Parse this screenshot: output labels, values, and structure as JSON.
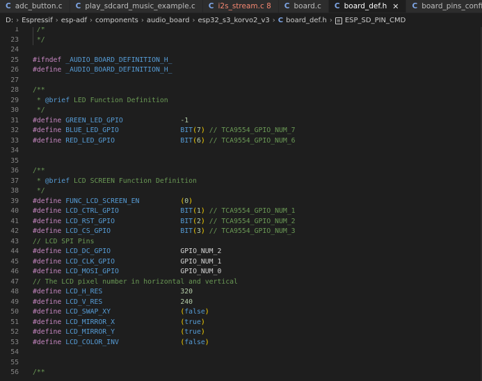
{
  "tabs": [
    {
      "label": "adc_button.c",
      "icon": "c-icon",
      "active": false,
      "error": false
    },
    {
      "label": "play_sdcard_music_example.c",
      "icon": "c-icon",
      "active": false,
      "error": false
    },
    {
      "label": "i2s_stream.c 8",
      "icon": "c-icon",
      "active": false,
      "error": true
    },
    {
      "label": "board.c",
      "icon": "c-icon",
      "active": false,
      "error": false
    },
    {
      "label": "board_def.h",
      "icon": "c-icon",
      "active": true,
      "error": false
    },
    {
      "label": "board_pins_config.c",
      "icon": "c-icon",
      "active": false,
      "error": false
    }
  ],
  "breadcrumb": {
    "items": [
      "D:",
      "Espressif",
      "esp-adf",
      "components",
      "audio_board",
      "esp32_s3_korvo2_v3",
      "board_def.h",
      "ESP_SD_PIN_CMD"
    ]
  },
  "editor": {
    "lines": [
      {
        "num": "1",
        "text": " /*"
      },
      {
        "num": "23",
        "text": " */"
      },
      {
        "num": "24",
        "text": ""
      },
      {
        "num": "25",
        "text": "#ifndef _AUDIO_BOARD_DEFINITION_H_"
      },
      {
        "num": "26",
        "text": "#define _AUDIO_BOARD_DEFINITION_H_"
      },
      {
        "num": "27",
        "text": ""
      },
      {
        "num": "28",
        "text": "/**"
      },
      {
        "num": "29",
        "text": " * @brief LED Function Definition"
      },
      {
        "num": "30",
        "text": " */"
      },
      {
        "num": "31",
        "text": "#define GREEN_LED_GPIO              -1"
      },
      {
        "num": "32",
        "text": "#define BLUE_LED_GPIO               BIT(7) // TCA9554_GPIO_NUM_7"
      },
      {
        "num": "33",
        "text": "#define RED_LED_GPIO                BIT(6) // TCA9554_GPIO_NUM_6"
      },
      {
        "num": "34",
        "text": ""
      },
      {
        "num": "35",
        "text": ""
      },
      {
        "num": "36",
        "text": "/**"
      },
      {
        "num": "37",
        "text": " * @brief LCD SCREEN Function Definition"
      },
      {
        "num": "38",
        "text": " */"
      },
      {
        "num": "39",
        "text": "#define FUNC_LCD_SCREEN_EN          (0)"
      },
      {
        "num": "40",
        "text": "#define LCD_CTRL_GPIO               BIT(1) // TCA9554_GPIO_NUM_1"
      },
      {
        "num": "41",
        "text": "#define LCD_RST_GPIO                BIT(2) // TCA9554_GPIO_NUM_2"
      },
      {
        "num": "42",
        "text": "#define LCD_CS_GPIO                 BIT(3) // TCA9554_GPIO_NUM_3"
      },
      {
        "num": "43",
        "text": "// LCD SPI Pins"
      },
      {
        "num": "44",
        "text": "#define LCD_DC_GPIO                 GPIO_NUM_2"
      },
      {
        "num": "45",
        "text": "#define LCD_CLK_GPIO                GPIO_NUM_1"
      },
      {
        "num": "46",
        "text": "#define LCD_MOSI_GPIO               GPIO_NUM_0"
      },
      {
        "num": "47",
        "text": "// The LCD pixel number in horizontal and vertical"
      },
      {
        "num": "48",
        "text": "#define LCD_H_RES                   320"
      },
      {
        "num": "49",
        "text": "#define LCD_V_RES                   240"
      },
      {
        "num": "50",
        "text": "#define LCD_SWAP_XY                 (false)"
      },
      {
        "num": "51",
        "text": "#define LCD_MIRROR_X                (true)"
      },
      {
        "num": "52",
        "text": "#define LCD_MIRROR_Y                (true)"
      },
      {
        "num": "53",
        "text": "#define LCD_COLOR_INV               (false)"
      },
      {
        "num": "54",
        "text": ""
      },
      {
        "num": "55",
        "text": ""
      },
      {
        "num": "56",
        "text": "/**"
      }
    ]
  },
  "colors": {
    "background": "#1e1e1e",
    "tab_bar": "#252526",
    "comment": "#6a9955",
    "preprocessor": "#c586c0",
    "macro": "#569cd6",
    "number": "#b5cea8",
    "bracket": "#ffd700",
    "line_number": "#858585",
    "error_tab": "#f48771"
  }
}
